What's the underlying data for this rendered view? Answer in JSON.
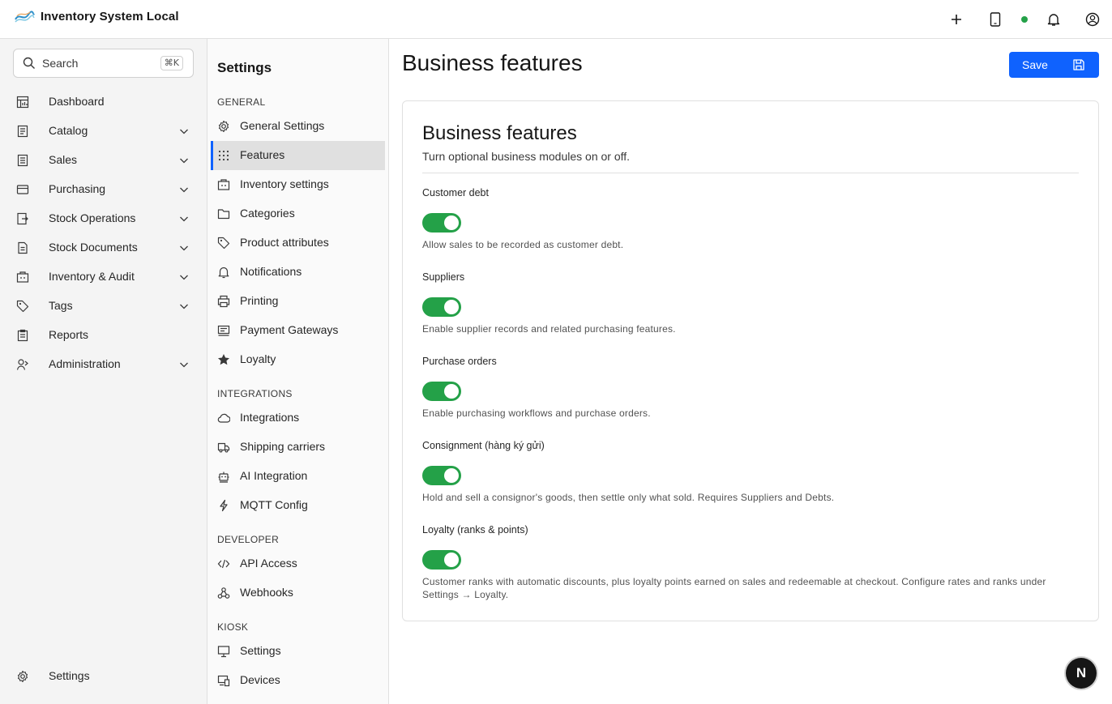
{
  "app": {
    "title": "Inventory System Local"
  },
  "colors": {
    "accent": "#0f62fe",
    "toggle_on": "#24a148",
    "status_online": "#24a148"
  },
  "header": {
    "icons": [
      "plus-icon",
      "tablet-icon",
      "status-dot",
      "bell-icon",
      "user-circle-icon"
    ]
  },
  "search": {
    "placeholder": "Search",
    "shortcut": "⌘K"
  },
  "sidebar": {
    "items": [
      {
        "label": "Dashboard",
        "icon": "dashboard-icon"
      },
      {
        "label": "Catalog",
        "icon": "catalog-icon",
        "expandable": true
      },
      {
        "label": "Sales",
        "icon": "sales-icon",
        "expandable": true
      },
      {
        "label": "Purchasing",
        "icon": "credit-card-icon",
        "expandable": true
      },
      {
        "label": "Stock Operations",
        "icon": "stock-operations-icon",
        "expandable": true
      },
      {
        "label": "Stock Documents",
        "icon": "document-icon",
        "expandable": true
      },
      {
        "label": "Inventory & Audit",
        "icon": "warehouse-icon",
        "expandable": true
      },
      {
        "label": "Tags",
        "icon": "tag-icon",
        "expandable": true
      },
      {
        "label": "Reports",
        "icon": "report-icon"
      },
      {
        "label": "Administration",
        "icon": "user-admin-icon",
        "expandable": true
      }
    ],
    "footer_label": "Settings"
  },
  "submenu": {
    "title": "Settings",
    "groups": [
      {
        "title": "GENERAL",
        "items": [
          {
            "label": "General Settings",
            "icon": "gear-icon"
          },
          {
            "label": "Features",
            "icon": "grid-icon",
            "active": true
          },
          {
            "label": "Inventory settings",
            "icon": "warehouse-icon"
          },
          {
            "label": "Categories",
            "icon": "folder-icon"
          },
          {
            "label": "Product attributes",
            "icon": "tag-icon"
          },
          {
            "label": "Notifications",
            "icon": "bell-icon"
          },
          {
            "label": "Printing",
            "icon": "printer-icon"
          },
          {
            "label": "Payment Gateways",
            "icon": "payment-icon"
          },
          {
            "label": "Loyalty",
            "icon": "star-icon"
          }
        ]
      },
      {
        "title": "INTEGRATIONS",
        "items": [
          {
            "label": "Integrations",
            "icon": "cloud-icon"
          },
          {
            "label": "Shipping carriers",
            "icon": "truck-icon"
          },
          {
            "label": "AI Integration",
            "icon": "robot-icon"
          },
          {
            "label": "MQTT Config",
            "icon": "lightning-icon"
          }
        ]
      },
      {
        "title": "DEVELOPER",
        "items": [
          {
            "label": "API Access",
            "icon": "code-icon"
          },
          {
            "label": "Webhooks",
            "icon": "webhook-icon"
          }
        ]
      },
      {
        "title": "KIOSK",
        "items": [
          {
            "label": "Settings",
            "icon": "monitor-icon"
          },
          {
            "label": "Devices",
            "icon": "devices-icon"
          }
        ]
      }
    ]
  },
  "main": {
    "title": "Business features",
    "save_label": "Save",
    "card": {
      "title": "Business features",
      "subtitle": "Turn optional business modules on or off.",
      "features": [
        {
          "label": "Customer debt",
          "enabled": true,
          "description": "Allow sales to be recorded as customer debt."
        },
        {
          "label": "Suppliers",
          "enabled": true,
          "description": "Enable supplier records and related purchasing features."
        },
        {
          "label": "Purchase orders",
          "enabled": true,
          "description": "Enable purchasing workflows and purchase orders."
        },
        {
          "label": "Consignment (hàng ký gửi)",
          "enabled": true,
          "description": "Hold and sell a consignor's goods, then settle only what sold. Requires Suppliers and Debts."
        },
        {
          "label": "Loyalty (ranks & points)",
          "enabled": true,
          "description": "Customer ranks with automatic discounts, plus loyalty points earned on sales and redeemable at checkout. Configure rates and ranks under Settings → Loyalty."
        }
      ]
    }
  },
  "fab": {
    "label": "N"
  }
}
